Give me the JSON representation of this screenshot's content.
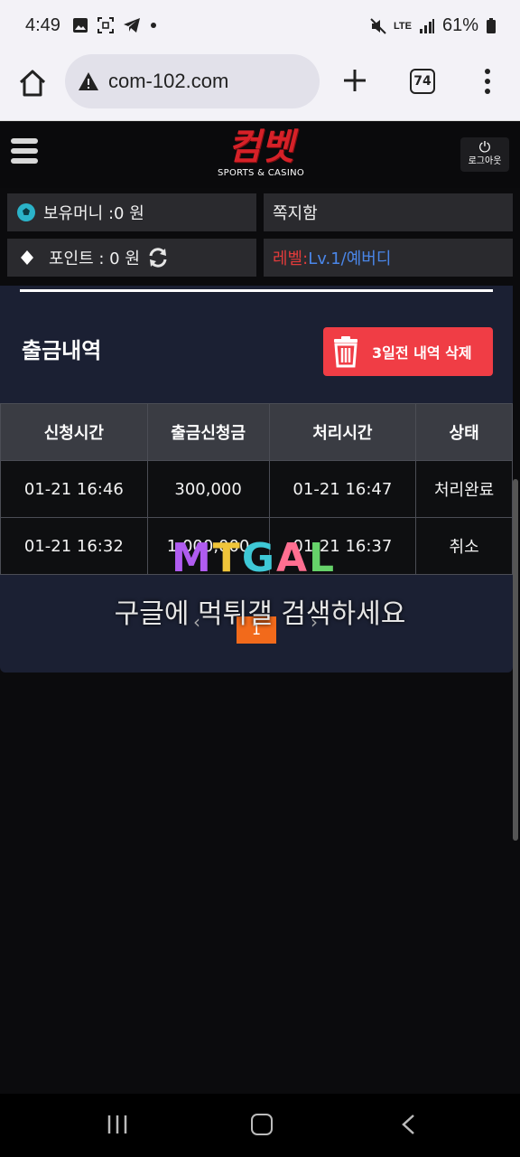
{
  "status_bar": {
    "time": "4:49",
    "battery": "61%",
    "network": "LTE"
  },
  "browser": {
    "url": "com-102.com",
    "tab_count": "74"
  },
  "site": {
    "brand": "컴벳",
    "brand_sub": "SPORTS & CASINO",
    "logout_label": "로그아웃",
    "brand_color": "#d62128"
  },
  "account": {
    "balance_label": "보유머니 :0 원",
    "messages_label": "쪽지함",
    "points_label": "포인트 :  0 원",
    "level_prefix": "레벨:",
    "level_value": "Lv.1/예버디"
  },
  "withdrawals": {
    "title": "출금내역",
    "delete_button": "3일전 내역 삭제",
    "columns": [
      "신청시간",
      "출금신청금",
      "처리시간",
      "상태"
    ],
    "rows": [
      {
        "requested": "01-21 16:46",
        "amount": "300,000",
        "processed": "01-21 16:47",
        "status": "처리완료"
      },
      {
        "requested": "01-21 16:32",
        "amount": "1,000,000",
        "processed": "01-21 16:37",
        "status": "취소"
      }
    ],
    "pager": {
      "prev": "‹",
      "current": "1",
      "next": "›"
    }
  },
  "watermark": {
    "logo": [
      "M",
      "T",
      "G",
      "A",
      "L"
    ],
    "text": "구글에 먹튀갤 검색하세요"
  },
  "colors": {
    "accent_red": "#f03d45",
    "panel_bg": "#1b2033",
    "pager_active": "#f26a1b",
    "level_link": "#4a86e8"
  }
}
